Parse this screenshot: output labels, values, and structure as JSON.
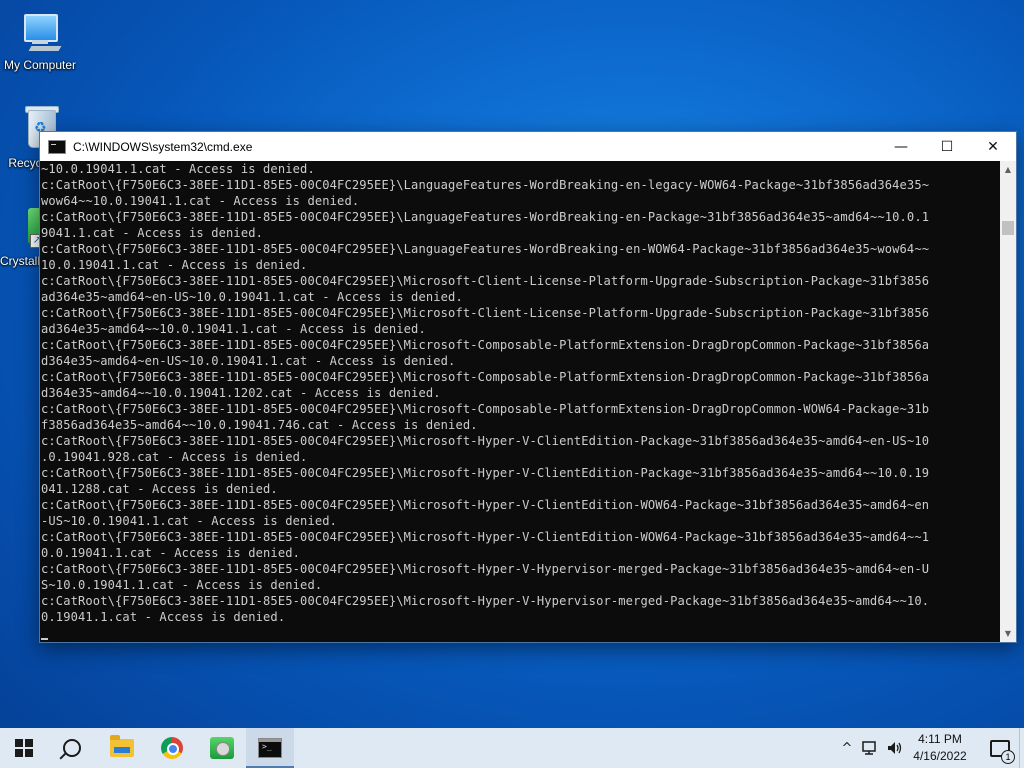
{
  "desktop": {
    "icons": [
      {
        "label": "My Computer"
      },
      {
        "label": "Recycle Bin"
      },
      {
        "label": "CrystalDiskInfo"
      }
    ]
  },
  "window": {
    "title": "C:\\WINDOWS\\system32\\cmd.exe",
    "minimize_glyph": "—",
    "maximize_glyph": "☐",
    "close_glyph": "✕",
    "console_lines": [
      "~10.0.19041.1.cat - Access is denied.",
      "c:CatRoot\\{F750E6C3-38EE-11D1-85E5-00C04FC295EE}\\LanguageFeatures-WordBreaking-en-legacy-WOW64-Package~31bf3856ad364e35~",
      "wow64~~10.0.19041.1.cat - Access is denied.",
      "c:CatRoot\\{F750E6C3-38EE-11D1-85E5-00C04FC295EE}\\LanguageFeatures-WordBreaking-en-Package~31bf3856ad364e35~amd64~~10.0.1",
      "9041.1.cat - Access is denied.",
      "c:CatRoot\\{F750E6C3-38EE-11D1-85E5-00C04FC295EE}\\LanguageFeatures-WordBreaking-en-WOW64-Package~31bf3856ad364e35~wow64~~",
      "10.0.19041.1.cat - Access is denied.",
      "c:CatRoot\\{F750E6C3-38EE-11D1-85E5-00C04FC295EE}\\Microsoft-Client-License-Platform-Upgrade-Subscription-Package~31bf3856",
      "ad364e35~amd64~en-US~10.0.19041.1.cat - Access is denied.",
      "c:CatRoot\\{F750E6C3-38EE-11D1-85E5-00C04FC295EE}\\Microsoft-Client-License-Platform-Upgrade-Subscription-Package~31bf3856",
      "ad364e35~amd64~~10.0.19041.1.cat - Access is denied.",
      "c:CatRoot\\{F750E6C3-38EE-11D1-85E5-00C04FC295EE}\\Microsoft-Composable-PlatformExtension-DragDropCommon-Package~31bf3856a",
      "d364e35~amd64~en-US~10.0.19041.1.cat - Access is denied.",
      "c:CatRoot\\{F750E6C3-38EE-11D1-85E5-00C04FC295EE}\\Microsoft-Composable-PlatformExtension-DragDropCommon-Package~31bf3856a",
      "d364e35~amd64~~10.0.19041.1202.cat - Access is denied.",
      "c:CatRoot\\{F750E6C3-38EE-11D1-85E5-00C04FC295EE}\\Microsoft-Composable-PlatformExtension-DragDropCommon-WOW64-Package~31b",
      "f3856ad364e35~amd64~~10.0.19041.746.cat - Access is denied.",
      "c:CatRoot\\{F750E6C3-38EE-11D1-85E5-00C04FC295EE}\\Microsoft-Hyper-V-ClientEdition-Package~31bf3856ad364e35~amd64~en-US~10",
      ".0.19041.928.cat - Access is denied.",
      "c:CatRoot\\{F750E6C3-38EE-11D1-85E5-00C04FC295EE}\\Microsoft-Hyper-V-ClientEdition-Package~31bf3856ad364e35~amd64~~10.0.19",
      "041.1288.cat - Access is denied.",
      "c:CatRoot\\{F750E6C3-38EE-11D1-85E5-00C04FC295EE}\\Microsoft-Hyper-V-ClientEdition-WOW64-Package~31bf3856ad364e35~amd64~en",
      "-US~10.0.19041.1.cat - Access is denied.",
      "c:CatRoot\\{F750E6C3-38EE-11D1-85E5-00C04FC295EE}\\Microsoft-Hyper-V-ClientEdition-WOW64-Package~31bf3856ad364e35~amd64~~1",
      "0.0.19041.1.cat - Access is denied.",
      "c:CatRoot\\{F750E6C3-38EE-11D1-85E5-00C04FC295EE}\\Microsoft-Hyper-V-Hypervisor-merged-Package~31bf3856ad364e35~amd64~en-U",
      "S~10.0.19041.1.cat - Access is denied.",
      "c:CatRoot\\{F750E6C3-38EE-11D1-85E5-00C04FC295EE}\\Microsoft-Hyper-V-Hypervisor-merged-Package~31bf3856ad364e35~amd64~~10.",
      "0.19041.1.cat - Access is denied."
    ]
  },
  "taskbar": {
    "tray": {
      "chevron": "^",
      "network_icon": "network-icon",
      "volume_icon": "volume-icon",
      "time": "4:11 PM",
      "date": "4/16/2022",
      "notification_count": "1"
    }
  },
  "colors": {
    "console_bg": "#0c0c0c",
    "console_text": "#cccccc",
    "taskbar_bg": "#dfe9f3",
    "desktop_blue": "#0f6fd3"
  }
}
